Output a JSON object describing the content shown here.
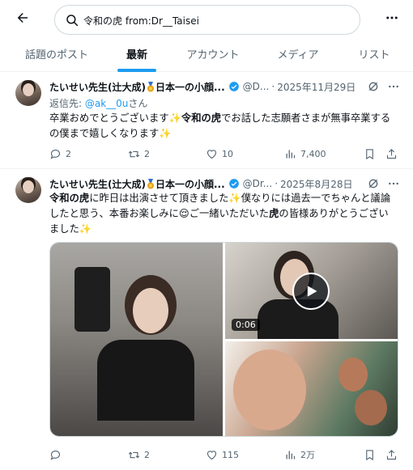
{
  "search": {
    "value": "令和の虎 from:Dr__Taisei"
  },
  "tabs": [
    {
      "label": "話題のポスト",
      "active": false
    },
    {
      "label": "最新",
      "active": true
    },
    {
      "label": "アカウント",
      "active": false
    },
    {
      "label": "メディア",
      "active": false
    },
    {
      "label": "リスト",
      "active": false
    }
  ],
  "tweets": [
    {
      "name_part1": "たいせい先生(辻大成)",
      "name_part2": "日本一の小顔...",
      "handle": "@D...",
      "time": "2025年11月29日",
      "reply_prefix": "返信先: ",
      "reply_to": "@ak__0u",
      "reply_suffix": "さん",
      "text_a": "卒業おめでとうございます",
      "text_b": "令和の虎",
      "text_c": "でお話した志願者さまが無事卒業する",
      "text_d": "の僕まで嬉しくなります",
      "replies": "2",
      "retweets": "2",
      "likes": "10",
      "views": "7,400"
    },
    {
      "name_part1": "たいせい先生(辻大成)",
      "name_part2": "日本一の小顔...",
      "handle": "@Dr...",
      "time": "2025年8月28日",
      "text_a": "令和の虎",
      "text_b": "に昨日は出演させて頂きました",
      "text_c": "僕なりには過去一でちゃんと議論",
      "text_d": "したと思う、本番お楽しみに",
      "text_e": "ご一緒いただいた",
      "text_f": "虎",
      "text_g": "の皆様ありがとうござい",
      "text_h": "ました",
      "video_duration": "0:06",
      "replies": "",
      "retweets": "2",
      "likes": "115",
      "views": "2万"
    }
  ],
  "colors": {
    "accent": "#1d9bf0",
    "text": "#0f1419",
    "muted": "#536471",
    "verified": "#1d9bf0",
    "sparkle": "#f5b400"
  },
  "icons": [
    "back-arrow-icon",
    "search-icon",
    "more-icon",
    "medal-icon",
    "verified-icon",
    "grok-icon",
    "reply-icon",
    "retweet-icon",
    "like-icon",
    "views-icon",
    "bookmark-icon",
    "share-icon",
    "play-icon"
  ]
}
